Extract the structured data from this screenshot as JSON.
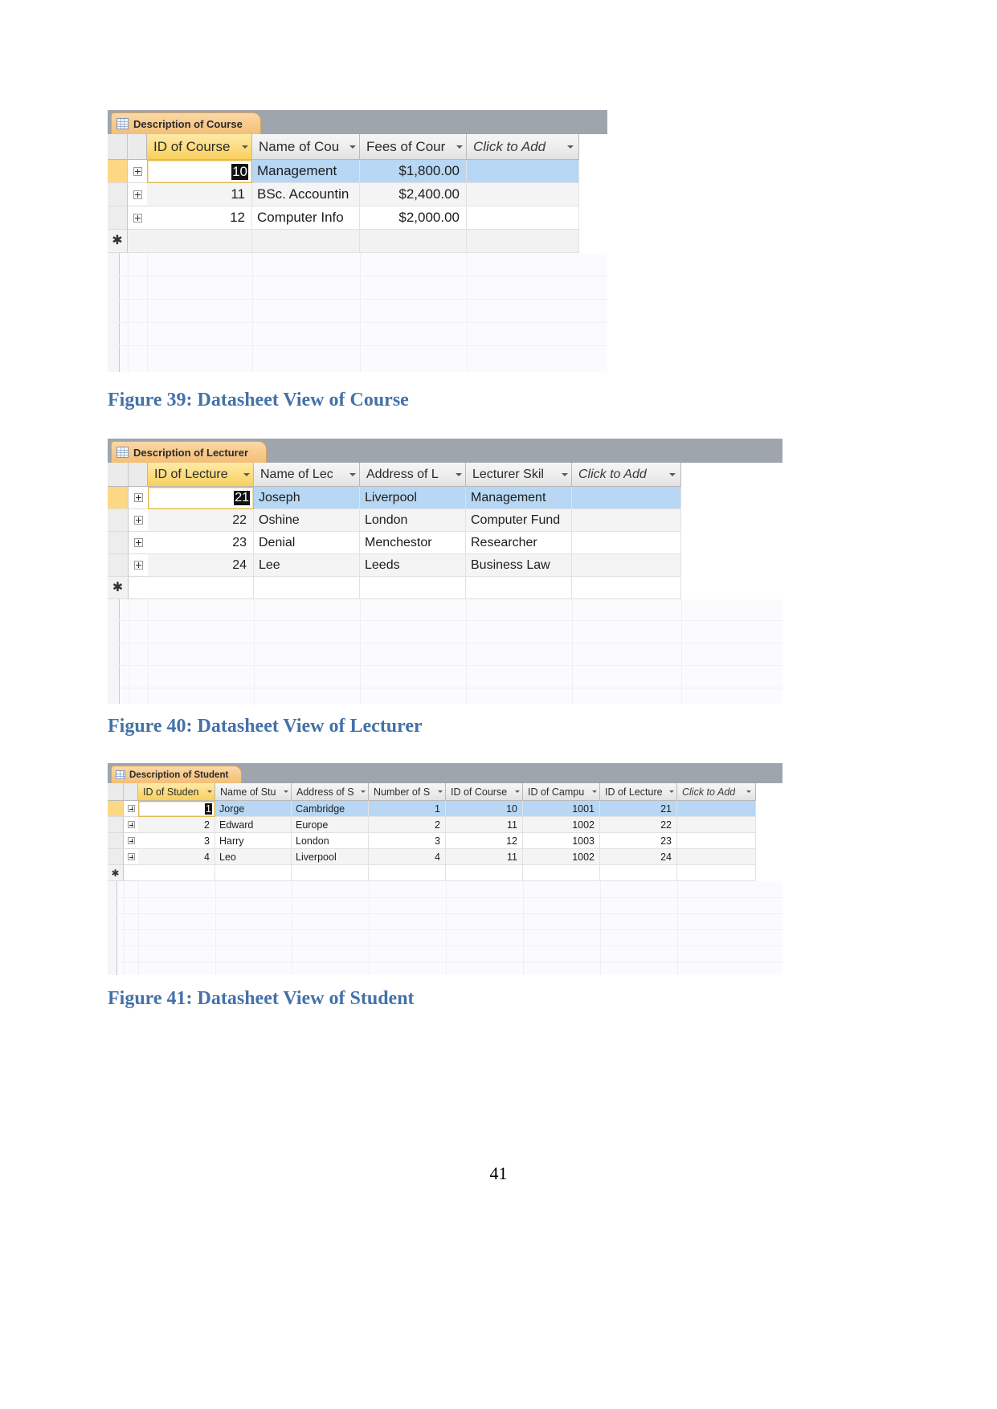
{
  "page": {
    "number": "41"
  },
  "figures": [
    {
      "id": "course",
      "tab_title": "Description of Course",
      "caption": "Figure 39: Datasheet View of Course",
      "columns": [
        {
          "label": "ID of Course",
          "has_caret": true,
          "selected": true,
          "align": "right"
        },
        {
          "label": "Name of Cou",
          "has_caret": true,
          "selected": false,
          "align": "left"
        },
        {
          "label": "Fees of Cour",
          "has_caret": true,
          "selected": false,
          "align": "right"
        },
        {
          "label": "Click to Add",
          "has_caret": true,
          "selected": false,
          "align": "left",
          "add_column": true
        }
      ],
      "rows": [
        {
          "selected": true,
          "cells": [
            "10",
            "Management",
            "$1,800.00",
            ""
          ],
          "active_cell": 0,
          "inverted_cell_text": "10"
        },
        {
          "selected": false,
          "cells": [
            "11",
            "BSc. Accountin",
            "$2,400.00",
            ""
          ]
        },
        {
          "selected": false,
          "cells": [
            "12",
            "Computer Info",
            "$2,000.00",
            ""
          ]
        }
      ],
      "new_row_marker": "✱"
    },
    {
      "id": "lecturer",
      "tab_title": "Description of Lecturer",
      "caption": "Figure 40: Datasheet View of Lecturer",
      "columns": [
        {
          "label": "ID of Lecture",
          "has_caret": true,
          "selected": true,
          "align": "right"
        },
        {
          "label": "Name of Lec",
          "has_caret": true,
          "selected": false,
          "align": "left"
        },
        {
          "label": "Address of L",
          "has_caret": true,
          "selected": false,
          "align": "left"
        },
        {
          "label": "Lecturer Skil",
          "has_caret": true,
          "selected": false,
          "align": "left"
        },
        {
          "label": "Click to Add",
          "has_caret": true,
          "selected": false,
          "align": "left",
          "add_column": true
        }
      ],
      "rows": [
        {
          "selected": true,
          "cells": [
            "21",
            "Joseph",
            "Liverpool",
            "Management",
            ""
          ],
          "active_cell": 0,
          "inverted_cell_text": "21"
        },
        {
          "selected": false,
          "cells": [
            "22",
            "Oshine",
            "London",
            "Computer Fund",
            ""
          ]
        },
        {
          "selected": false,
          "cells": [
            "23",
            "Denial",
            "Menchestor",
            "Researcher",
            ""
          ]
        },
        {
          "selected": false,
          "cells": [
            "24",
            "Lee",
            "Leeds",
            "Business Law",
            ""
          ]
        }
      ],
      "new_row_marker": "✱"
    },
    {
      "id": "student",
      "tab_title": "Description of Student",
      "caption": "Figure 41: Datasheet View of Student",
      "columns": [
        {
          "label": "ID of Studen",
          "has_caret": true,
          "selected": true,
          "align": "right"
        },
        {
          "label": "Name of Stu",
          "has_caret": true,
          "selected": false,
          "align": "left"
        },
        {
          "label": "Address of S",
          "has_caret": true,
          "selected": false,
          "align": "left"
        },
        {
          "label": "Number of S",
          "has_caret": true,
          "selected": false,
          "align": "right"
        },
        {
          "label": "ID of Course",
          "has_caret": true,
          "selected": false,
          "align": "right"
        },
        {
          "label": "ID of Campu",
          "has_caret": true,
          "selected": false,
          "align": "right"
        },
        {
          "label": "ID of Lecture",
          "has_caret": true,
          "selected": false,
          "align": "right"
        },
        {
          "label": "Click to Add",
          "has_caret": true,
          "selected": false,
          "align": "left",
          "add_column": true
        }
      ],
      "rows": [
        {
          "selected": true,
          "cells": [
            "1",
            "Jorge",
            "Cambridge",
            "1",
            "10",
            "1001",
            "21",
            ""
          ],
          "active_cell": 0,
          "inverted_cell_text": "1"
        },
        {
          "selected": false,
          "cells": [
            "2",
            "Edward",
            "Europe",
            "2",
            "11",
            "1002",
            "22",
            ""
          ]
        },
        {
          "selected": false,
          "cells": [
            "3",
            "Harry",
            "London",
            "3",
            "12",
            "1003",
            "23",
            ""
          ]
        },
        {
          "selected": false,
          "cells": [
            "4",
            "Leo",
            "Liverpool",
            "4",
            "11",
            "1002",
            "24",
            ""
          ]
        }
      ],
      "new_row_marker": "✱"
    }
  ],
  "colors": {
    "caption": "#4472a8",
    "tab_orange": "#f7c98a",
    "tab_bar": "#9fa5ad",
    "selected_row": "#b7d7f4",
    "selected_header": "#fcdc7e",
    "current_record_marker": "#fdd884"
  }
}
